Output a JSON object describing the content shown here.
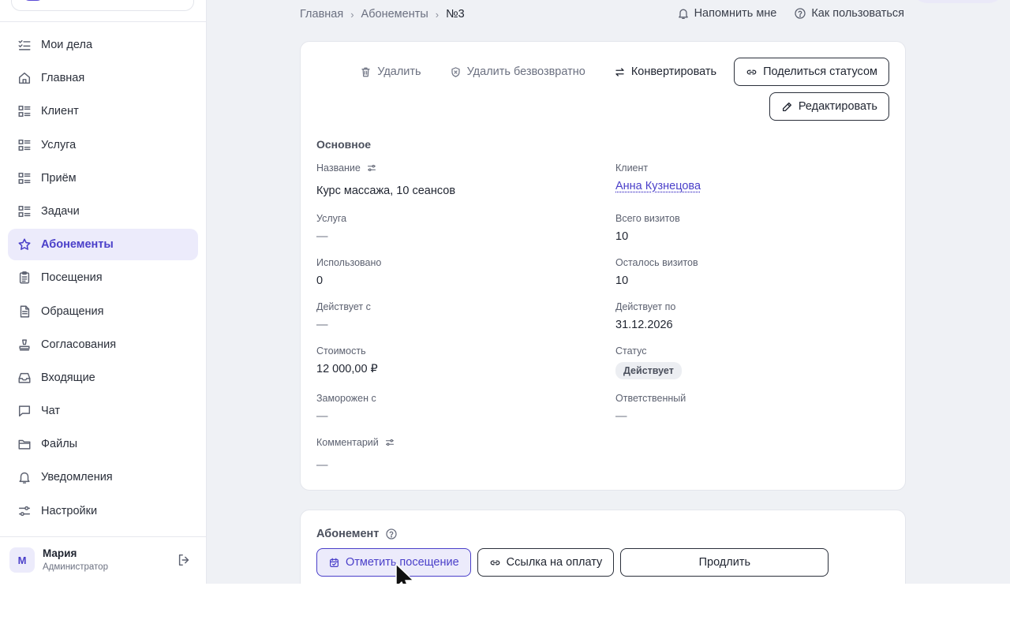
{
  "sidebar": {
    "items": [
      {
        "label": "Мои дела",
        "icon": "checklist-icon"
      },
      {
        "label": "Главная",
        "icon": "home-icon"
      },
      {
        "label": "Клиент",
        "icon": "list-icon"
      },
      {
        "label": "Услуга",
        "icon": "list-icon"
      },
      {
        "label": "Приём",
        "icon": "list-icon"
      },
      {
        "label": "Задачи",
        "icon": "list-icon"
      },
      {
        "label": "Абонементы",
        "icon": "star-icon",
        "active": true
      },
      {
        "label": "Посещения",
        "icon": "clipboard-icon"
      },
      {
        "label": "Обращения",
        "icon": "document-icon"
      },
      {
        "label": "Согласования",
        "icon": "stamp-icon"
      },
      {
        "label": "Входящие",
        "icon": "inbox-icon"
      },
      {
        "label": "Чат",
        "icon": "chat-icon"
      },
      {
        "label": "Файлы",
        "icon": "folder-icon"
      },
      {
        "label": "Уведомления",
        "icon": "bell-icon"
      },
      {
        "label": "Настройки",
        "icon": "settings-sliders-icon"
      }
    ],
    "user": {
      "initial": "М",
      "name": "Мария",
      "role": "Администратор"
    }
  },
  "breadcrumb": {
    "home": "Главная",
    "section": "Абонементы",
    "current": "№3"
  },
  "top_links": {
    "remind": "Напомнить мне",
    "help": "Как пользоваться"
  },
  "actions": {
    "delete": "Удалить",
    "delete_forever": "Удалить безвозвратно",
    "convert": "Конвертировать",
    "share_status": "Поделиться статусом",
    "edit": "Редактировать"
  },
  "details": {
    "section_title": "Основное",
    "name_label": "Название",
    "name_value": "Курс массажа, 10 сеансов",
    "client_label": "Клиент",
    "client_value": "Анна Кузнецова",
    "service_label": "Услуга",
    "service_value": "—",
    "total_visits_label": "Всего визитов",
    "total_visits_value": "10",
    "used_label": "Использовано",
    "used_value": "0",
    "remaining_label": "Осталось визитов",
    "remaining_value": "10",
    "valid_from_label": "Действует с",
    "valid_from_value": "—",
    "valid_to_label": "Действует по",
    "valid_to_value": "31.12.2026",
    "price_label": "Стоимость",
    "price_value": "12 000,00 ₽",
    "status_label": "Статус",
    "status_value": "Действует",
    "frozen_label": "Заморожен с",
    "frozen_value": "—",
    "responsible_label": "Ответственный",
    "responsible_value": "—",
    "comment_label": "Комментарий",
    "comment_value": "—"
  },
  "subscription": {
    "title": "Абонемент",
    "mark_visit": "Отметить посещение",
    "payment_link": "Ссылка на оплату",
    "extend": "Продлить"
  },
  "colors": {
    "accent": "#4a3fc9",
    "accent_bg": "#ecebfb",
    "main_bg": "#eff1f5"
  }
}
